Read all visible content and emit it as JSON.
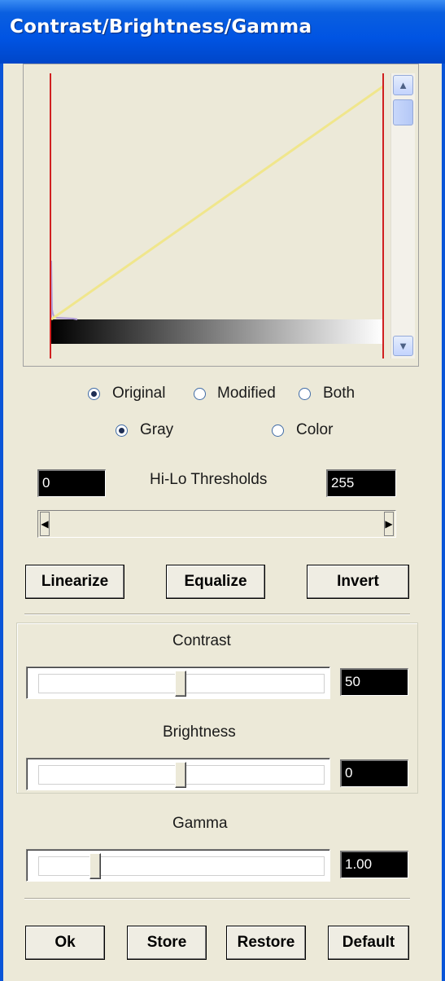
{
  "window": {
    "title": "Contrast/Brightness/Gamma"
  },
  "view_mode": {
    "options": [
      "Original",
      "Modified",
      "Both"
    ],
    "selected": "Original"
  },
  "color_mode": {
    "options": [
      "Gray",
      "Color"
    ],
    "selected": "Gray"
  },
  "thresholds": {
    "label": "Hi-Lo Thresholds",
    "low": "0",
    "high": "255"
  },
  "actions": {
    "linearize": "Linearize",
    "equalize": "Equalize",
    "invert": "Invert"
  },
  "contrast": {
    "label": "Contrast",
    "value": "50",
    "level": 0.5
  },
  "brightness": {
    "label": "Brightness",
    "value": "0",
    "level": 0.5
  },
  "gamma": {
    "label": "Gamma",
    "value": "1.00",
    "level": 0.2
  },
  "footer": {
    "ok": "Ok",
    "store": "Store",
    "restore": "Restore",
    "default": "Default"
  },
  "colors": {
    "titlebar": "#0054E3",
    "curve": "#F0E68C",
    "threshold_lines": "#D02020",
    "field_bg": "#000000"
  },
  "icons": {
    "scroll_up": "chevron-up-icon",
    "scroll_down": "chevron-down-icon",
    "left": "arrow-left-icon",
    "right": "arrow-right-icon"
  }
}
